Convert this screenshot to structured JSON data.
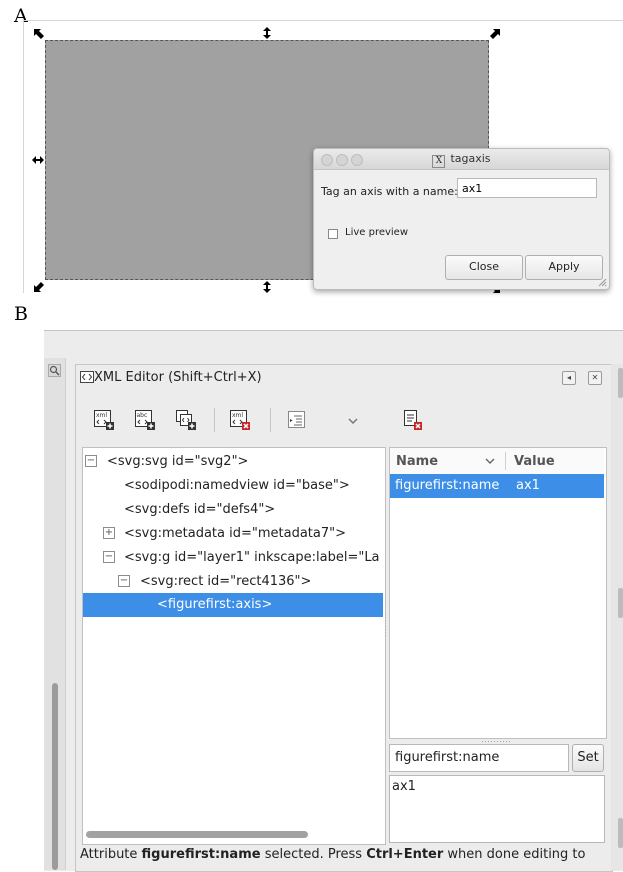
{
  "panels": {
    "a_label": "A",
    "b_label": "B"
  },
  "dialog": {
    "title": "tagaxis",
    "prompt_label": "Tag an axis with a name:",
    "axis_name_value": "ax1",
    "live_preview_label": "Live preview",
    "live_preview_checked": false,
    "close_label": "Close",
    "apply_label": "Apply"
  },
  "xml_editor": {
    "title": "XML Editor (Shift+Ctrl+X)",
    "toolbar_icons": [
      "new-element-node-icon",
      "new-text-node-icon",
      "duplicate-node-icon",
      "delete-node-icon",
      "indent-node-icon",
      "chevron-down-icon",
      "delete-attribute-icon"
    ],
    "tree": [
      {
        "text": "<svg:svg id=\"svg2\">",
        "expander": "−"
      },
      {
        "text": "<sodipodi:namedview id=\"base\">",
        "expander": ""
      },
      {
        "text": "<svg:defs id=\"defs4\">",
        "expander": ""
      },
      {
        "text": "<svg:metadata id=\"metadata7\">",
        "expander": "+"
      },
      {
        "text": "<svg:g id=\"layer1\" inkscape:label=\"La",
        "expander": "−"
      },
      {
        "text": "<svg:rect id=\"rect4136\">",
        "expander": "−"
      },
      {
        "text": "<figurefirst:axis>",
        "expander": ""
      }
    ],
    "attributes": {
      "name_header": "Name",
      "value_header": "Value",
      "rows": [
        {
          "name": "figurefirst:name",
          "value": "ax1"
        }
      ]
    },
    "attr_name_field": "figurefirst:name",
    "set_label": "Set",
    "attr_value_text": "ax1",
    "status": {
      "prefix": "Attribute ",
      "bold_name": "figurefirst:name",
      "middle": " selected. Press ",
      "bold_key": "Ctrl+Enter",
      "suffix": " when done editing to"
    }
  },
  "colors": {
    "selection": "#3d8ee6",
    "canvas_rect": "#a1a1a1"
  }
}
